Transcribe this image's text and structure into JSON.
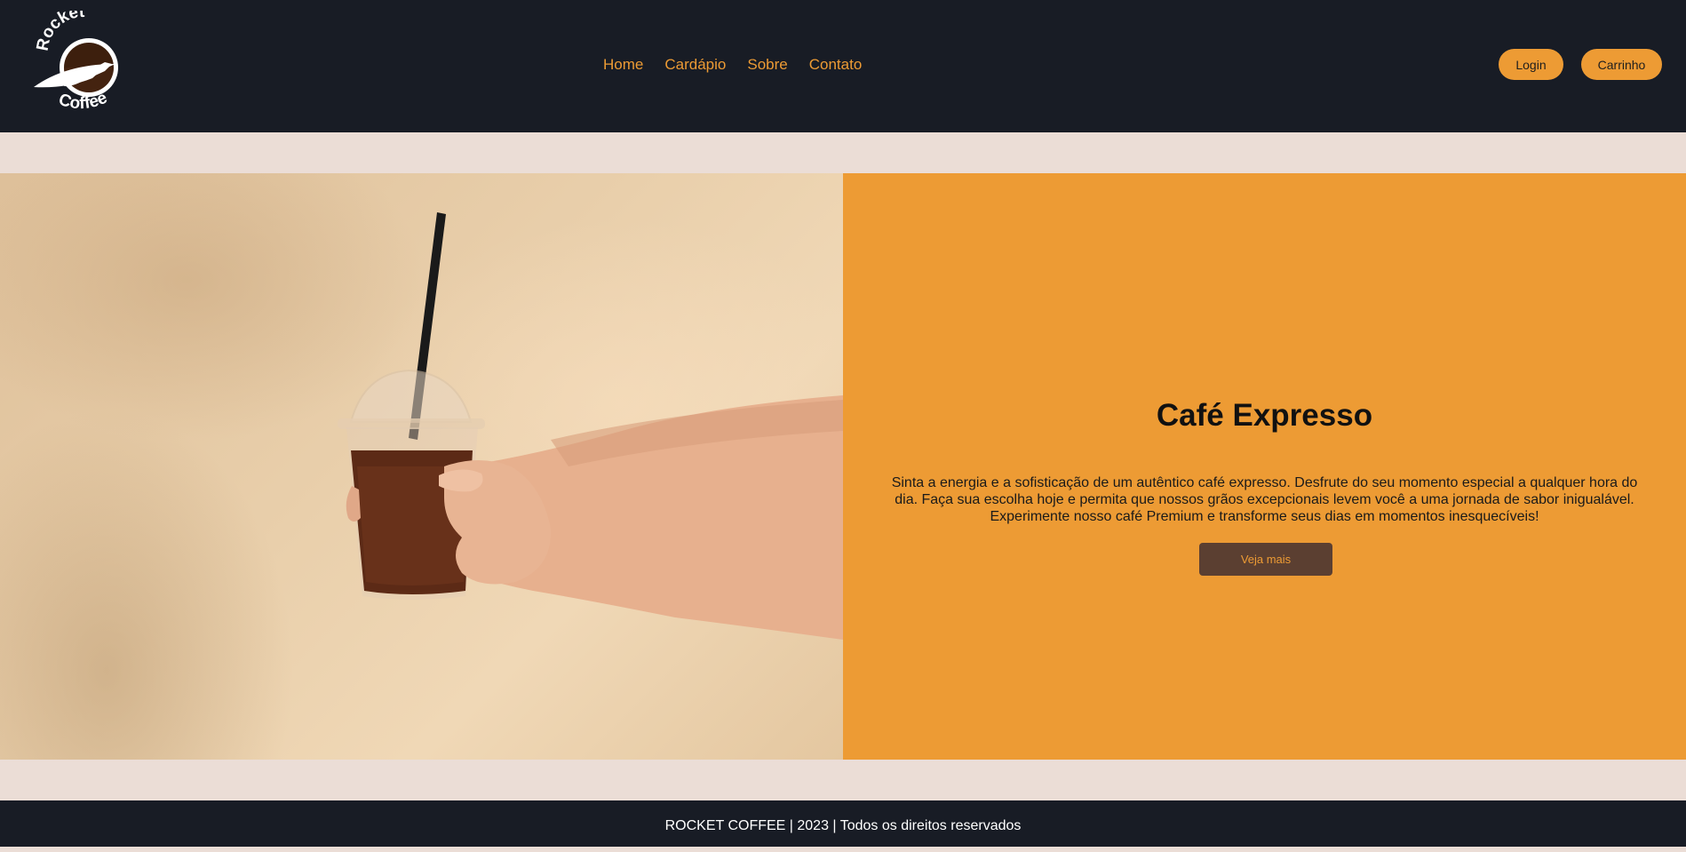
{
  "brand": {
    "logo_top_text": "Rocket",
    "logo_bottom_text": "Coffee"
  },
  "nav": {
    "items": [
      {
        "label": "Home"
      },
      {
        "label": "Cardápio"
      },
      {
        "label": "Sobre"
      },
      {
        "label": "Contato"
      }
    ]
  },
  "header_buttons": {
    "login": "Login",
    "cart": "Carrinho"
  },
  "hero": {
    "image_alt": "hand holding iced coffee cup with straw",
    "title": "Café Expresso",
    "description": "Sinta a energia e a sofisticação de um autêntico café expresso. Desfrute do seu momento especial a qualquer hora do dia. Faça sua escolha hoje e permita que nossos grãos excepcionais levem você a uma jornada de sabor inigualável. Experimente nosso café Premium e transforme seus dias em momentos inesquecíveis!",
    "cta": "Veja mais"
  },
  "footer": {
    "text": "ROCKET COFFEE | 2023 | Todos os direitos reservados"
  },
  "colors": {
    "header_bg": "#181C25",
    "accent": "#ED9B34",
    "page_bg": "#EBDDD6",
    "button_dark": "#5B3F31"
  }
}
